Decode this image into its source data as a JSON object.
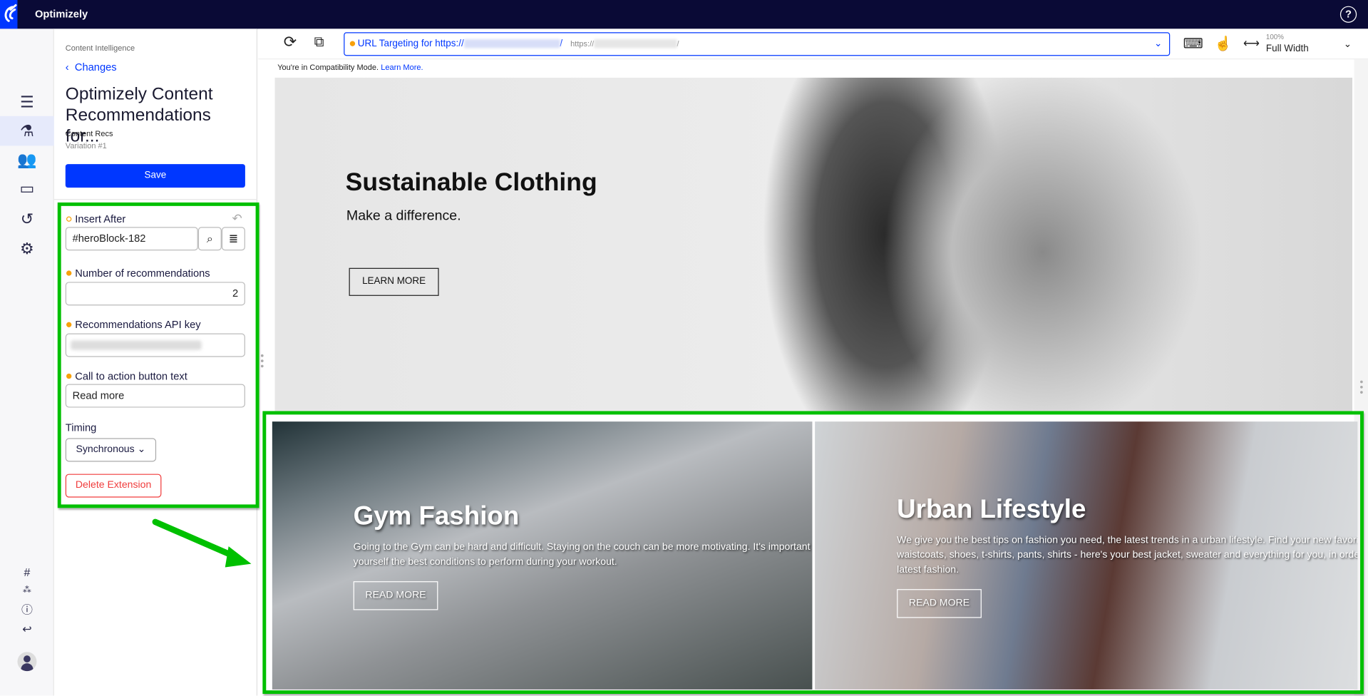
{
  "app": {
    "brand": "Optimizely",
    "help_icon": "?"
  },
  "rail": {
    "items": [
      "list-icon",
      "flask-icon",
      "audiences-icon",
      "pages-icon",
      "history-icon",
      "settings-icon"
    ],
    "bottom": [
      "hash-icon",
      "graph-icon",
      "help-icon",
      "exit-icon"
    ]
  },
  "panel": {
    "breadcrumb": "Content Intelligence",
    "back": "Changes",
    "title": "Optimizely Content Recommendations for...",
    "experiment": "Content Recs",
    "variation": "Variation #1",
    "save": "Save",
    "fields": {
      "insert_after": {
        "label": "Insert After",
        "value": "#heroBlock-182"
      },
      "num_recs": {
        "label": "Number of recommendations",
        "value": "2"
      },
      "api_key": {
        "label": "Recommendations API key"
      },
      "cta": {
        "label": "Call to action button text",
        "value": "Read more"
      },
      "timing": {
        "label": "Timing",
        "value": "Synchronous"
      }
    },
    "delete": "Delete Extension"
  },
  "toolbar": {
    "url_label": "URL Targeting for https://",
    "url_suffix": "/",
    "url_secondary": "https://",
    "zoom": "100%",
    "width_mode": "Full Width"
  },
  "compat": {
    "text": "You're in Compatibility Mode.",
    "link": "Learn More."
  },
  "hero": {
    "title": "Sustainable Clothing",
    "subtitle": "Make a difference.",
    "button": "LEARN MORE"
  },
  "cards": [
    {
      "title": "Gym Fashion",
      "line1": "Going to the Gym can be hard and difficult. Staying on the couch can be more motivating. It's important t",
      "line2": "yourself the best conditions to perform during your workout.",
      "button": "READ MORE"
    },
    {
      "title": "Urban Lifestyle",
      "line1": "We give you the best tips on fashion you need, the latest trends in a urban lifestyle. Find your new favorit",
      "line2": "waistcoats, shoes, t-shirts, pants, shirts - here's your best jacket, sweater and everything for you, in order",
      "line3": "latest fashion.",
      "button": "READ MORE"
    }
  ],
  "colors": {
    "accent": "#0037ff",
    "topbar": "#0a0a36",
    "highlight": "#00c000",
    "required": "#f7a00a",
    "danger": "#f03c3c"
  }
}
